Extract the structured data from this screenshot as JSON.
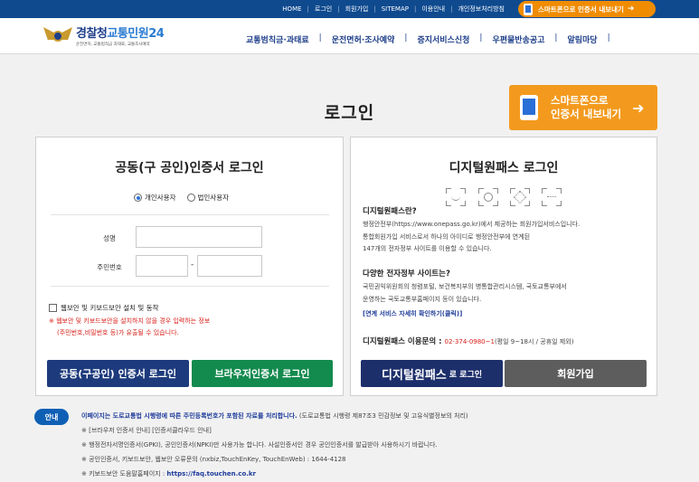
{
  "util_links": [
    "HOME",
    "로그인",
    "회원가입",
    "SITEMAP",
    "이용안내",
    "개인정보처리방침"
  ],
  "top_button": "스마트폰으로 인증서 내보내기",
  "logo": {
    "main": "경찰청",
    "highlight": "교통민원24",
    "sub": "운전면허, 교통범칙금 과태료, 교통조사예약"
  },
  "gnb": [
    "교통범칙금·과태료",
    "운전면허·조사예약",
    "증지서비스신청",
    "우편물반송공고",
    "알림마당"
  ],
  "page_title": "로그인",
  "phone_button": {
    "line1": "스마트폰으로",
    "line2": "인증서 내보내기"
  },
  "left_panel": {
    "title": "공동(구 공인)인증서 로그인",
    "radio_personal": "개인사용자",
    "radio_corporate": "법인사용자",
    "name_label": "성명",
    "rrn_label": "주민번호",
    "dash": "-",
    "checkbox_label": "웹보안 및 키보드보안 설치 및 동작",
    "warn_line1": "※ 웹보안 및 키보드보안을 설치하지 않을 경우 입력하는 정보",
    "warn_line2": "(주민번호,비밀번호 등)가 유출될 수 있습니다.",
    "btn_cert": "공동(구공인) 인증서 로그인",
    "btn_browser": "브라우저인증서 로그인"
  },
  "right_panel": {
    "title": "디지털원패스 로그인",
    "q1": "디지털원패스란?",
    "p1_line1": "행정안전부(https://www.onepass.go.kr)에서 제공하는 회원가입서비스입니다.",
    "p1_line2": "통합회원가입 서비스로서 하나의 아이디로 행정안전부에 연계된",
    "p1_line3": "147개의 전자정부 사이트를 이용할 수 있습니다.",
    "q2": "다양한 전자정부 사이트는?",
    "p2_line1": "국민권익위원회의 청렴포털, 보건복지부의 병통합관리시스템, 국토교통부에서",
    "p2_line2": "운영하는 국토교통부홈페이지 등이 있습니다.",
    "link": "[연계 서비스 자세히 확인하기(클릭)]",
    "call_label": "디지털원패스 이용문의 :",
    "call_number": "02-374-0980~1",
    "call_hours": "(평일 9~18시 / 공휴일 제외)",
    "btn_onepass_big": "디지털원패스",
    "btn_onepass_small": "로 로그인",
    "btn_join": "회원가입"
  },
  "notice": {
    "badge": "안내",
    "line1_bold": "이페이지는 도로교통법 시행령에 따른 주민등록번호가 포함된 자료를 처리합니다.",
    "line1_rest": "(도로교통법 시행령 제87조3 민감정보 및 고유식별정보의 처리)",
    "line2": "※ [브라우저 인증서 안내] [인증서클라우드 안내]",
    "line3": "※ 행정전자서명인증서(GPKI), 공인인증서(NPKI)만 사용가능 합니다. 사설인증서인 경우 공인인증서를 발급받아 사용하시기 바랍니다.",
    "line4": "※ 공인인증서, 키보드보안, 웹보안 오류문의 (nxbiz,TouchEnKey, TouchEnWeb) : 1644-4128",
    "line5_label": "※ 키보드보안 도움말홈페이지 :",
    "line5_url": "https://faq.touchen.co.kr"
  },
  "colors": {
    "primary": "#0f4a8f",
    "accent": "#f39a1e",
    "cert_button": "#1d3b7c",
    "browser_button": "#138a4e",
    "join_button": "#5d5d5d",
    "warning": "#d8201a"
  }
}
